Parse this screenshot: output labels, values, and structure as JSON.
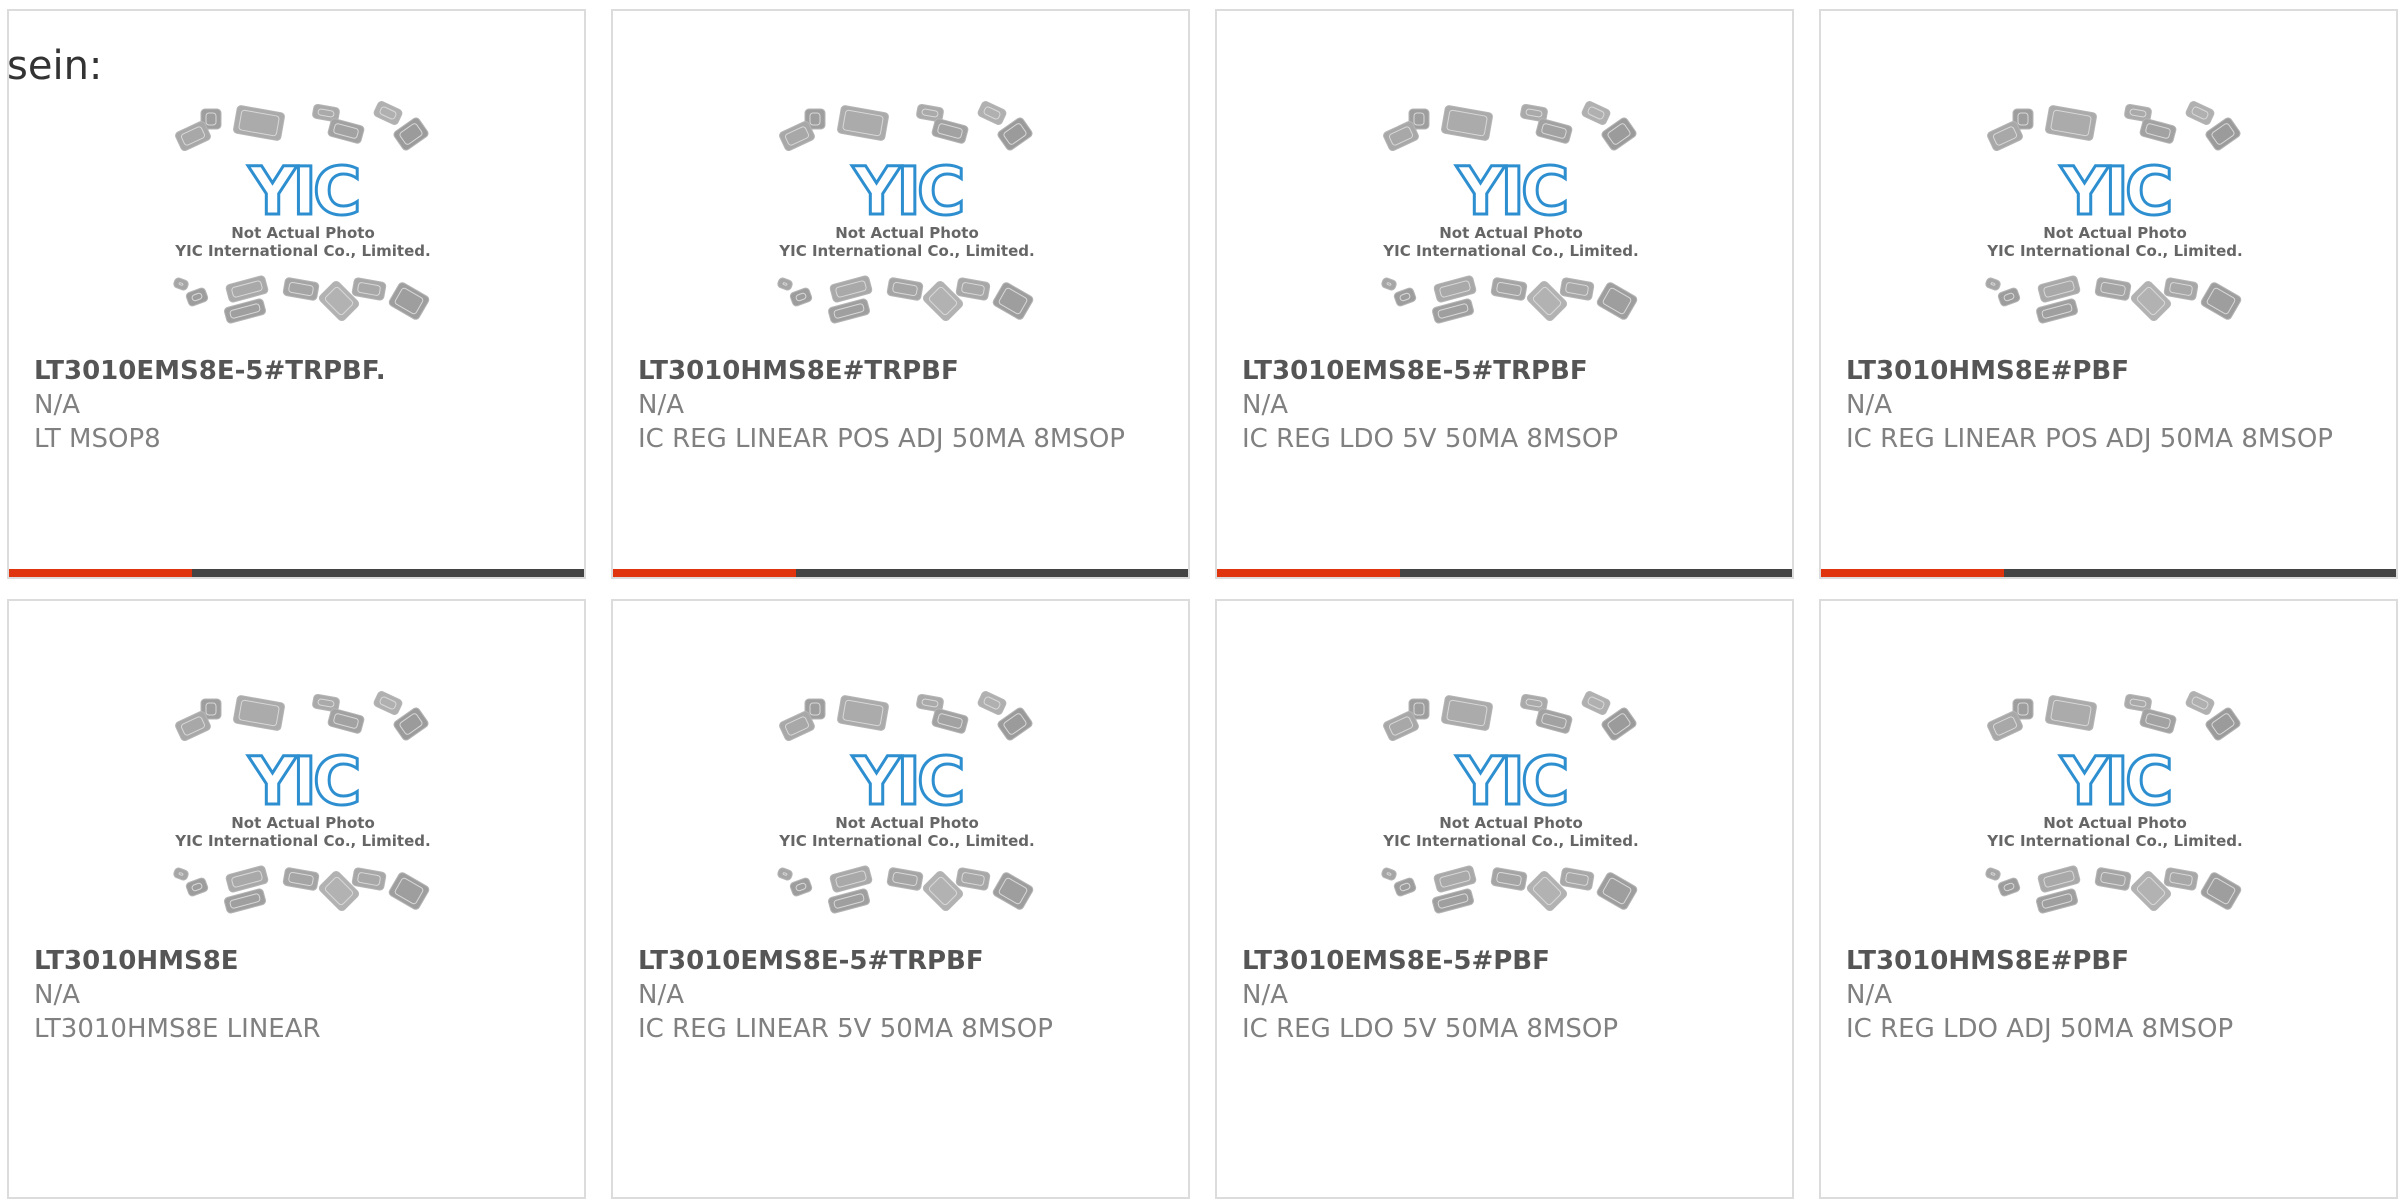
{
  "heading": "sein:",
  "placeholder": {
    "logo_text": "YIC",
    "line1": "Not Actual Photo",
    "line2": "YIC International Co., Limited."
  },
  "colors": {
    "accent": "#e0340f",
    "bar": "#444444",
    "logo_blue": "#2e8fd0"
  },
  "products": [
    {
      "part": "LT3010EMS8E-5#TRPBF.",
      "manufacturer": "N/A",
      "description": "LT MSOP8"
    },
    {
      "part": "LT3010HMS8E#TRPBF",
      "manufacturer": "N/A",
      "description": "IC REG LINEAR POS ADJ 50MA 8MSOP"
    },
    {
      "part": "LT3010EMS8E-5#TRPBF",
      "manufacturer": "N/A",
      "description": "IC REG LDO 5V 50MA 8MSOP"
    },
    {
      "part": "LT3010HMS8E#PBF",
      "manufacturer": "N/A",
      "description": "IC REG LINEAR POS ADJ 50MA 8MSOP"
    },
    {
      "part": "LT3010HMS8E",
      "manufacturer": "N/A",
      "description": "LT3010HMS8E LINEAR"
    },
    {
      "part": "LT3010EMS8E-5#TRPBF",
      "manufacturer": "N/A",
      "description": "IC REG LINEAR 5V 50MA 8MSOP"
    },
    {
      "part": "LT3010EMS8E-5#PBF",
      "manufacturer": "N/A",
      "description": "IC REG LDO 5V 50MA 8MSOP"
    },
    {
      "part": "LT3010HMS8E#PBF",
      "manufacturer": "N/A",
      "description": "IC REG LDO ADJ 50MA 8MSOP"
    }
  ]
}
